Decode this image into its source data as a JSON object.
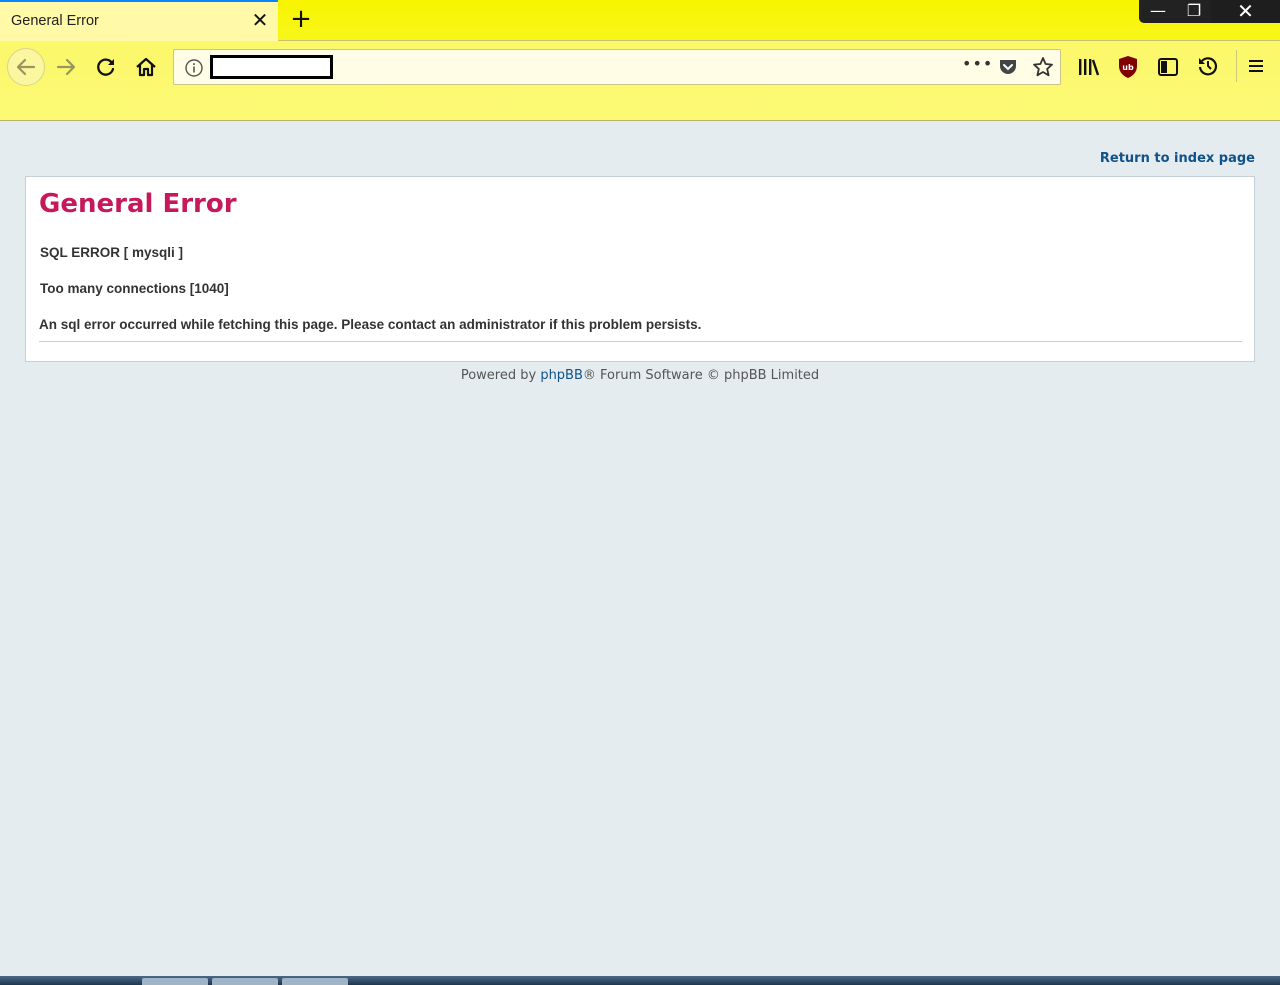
{
  "browser": {
    "tab_title": "General Error",
    "tab_close": "✕",
    "new_tab": "+",
    "window_min": "—",
    "window_max": "❐",
    "window_close": "✕",
    "url_dots": "•••"
  },
  "page": {
    "return_link": "Return to index page",
    "title": "General Error",
    "sql_error": "SQL ERROR [ mysqli ]",
    "connections": "Too many connections [1040]",
    "message": "An sql error occurred while fetching this page. Please contact an administrator if this problem persists.",
    "footer_prefix": "Powered by ",
    "footer_link": "phpBB",
    "footer_suffix": "® Forum Software © phpBB Limited"
  },
  "colors": {
    "title": "#c5195b",
    "link": "#105289",
    "chrome": "#f7f500"
  }
}
